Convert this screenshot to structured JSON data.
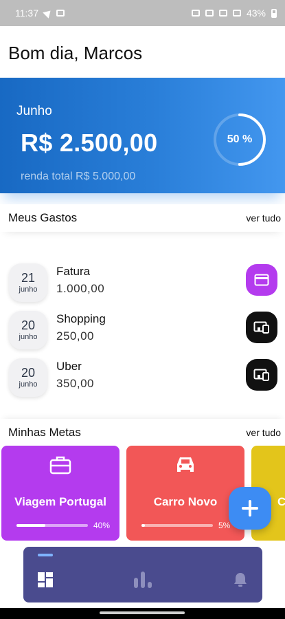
{
  "status_bar": {
    "time": "11:37",
    "battery": "43%"
  },
  "greeting": "Bom dia, Marcos",
  "summary": {
    "month": "Junho",
    "amount": "R$ 2.500,00",
    "total_income": "renda total R$ 5.000,00",
    "progress_label": "50 %",
    "progress": 0.5
  },
  "expenses": {
    "title": "Meus Gastos",
    "see_all": "ver tudo",
    "items": [
      {
        "day": "21",
        "month": "junho",
        "name": "Fatura",
        "value": "1.000,00",
        "icon": "credit-card-icon",
        "color": "#b43bee"
      },
      {
        "day": "20",
        "month": "junho",
        "name": "Shopping",
        "value": "250,00",
        "icon": "devices-icon",
        "color": "#111111"
      },
      {
        "day": "20",
        "month": "junho",
        "name": "Uber",
        "value": "350,00",
        "icon": "devices-icon",
        "color": "#111111"
      }
    ]
  },
  "goals": {
    "title": "Minhas Metas",
    "see_all": "ver tudo",
    "items": [
      {
        "name": "Viagem Portugal",
        "percent_label": "40%",
        "progress": 0.4,
        "icon": "suitcase-icon",
        "color": "#b43bee"
      },
      {
        "name": "Carro Novo",
        "percent_label": "5%",
        "progress": 0.05,
        "icon": "car-icon",
        "color": "#f25757"
      },
      {
        "name": "C",
        "percent_label": "",
        "progress": 0,
        "icon": "",
        "color": "#e3c51b"
      }
    ]
  },
  "fab": {
    "icon": "plus-icon",
    "color": "#3d8cf3"
  },
  "bottom_nav": {
    "color": "#4a4b8e",
    "items": [
      {
        "icon": "dashboard-icon",
        "active": true
      },
      {
        "icon": "bar-chart-icon",
        "active": false
      },
      {
        "icon": "bell-icon",
        "active": false
      }
    ]
  }
}
